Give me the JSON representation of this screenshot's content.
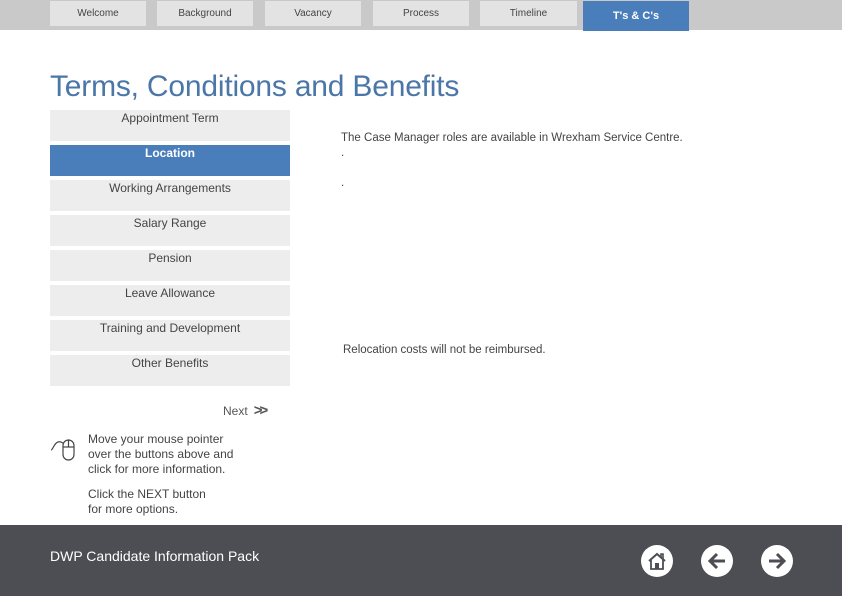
{
  "nav": {
    "tabs": [
      {
        "label": "Welcome",
        "active": false
      },
      {
        "label": "Background",
        "active": false
      },
      {
        "label": "Vacancy",
        "active": false
      },
      {
        "label": "Process",
        "active": false
      },
      {
        "label": "Timeline",
        "active": false
      },
      {
        "label": "T's & C's",
        "active": true
      }
    ]
  },
  "page": {
    "title": "Terms, Conditions and Benefits"
  },
  "menu": {
    "items": [
      {
        "label": "Appointment Term",
        "active": false
      },
      {
        "label": "Location",
        "active": true
      },
      {
        "label": "Working Arrangements",
        "active": false
      },
      {
        "label": "Salary Range",
        "active": false
      },
      {
        "label": "Pension",
        "active": false
      },
      {
        "label": "Leave Allowance",
        "active": false
      },
      {
        "label": "Training and Development",
        "active": false
      },
      {
        "label": "Other Benefits",
        "active": false
      }
    ]
  },
  "content": {
    "line1": "The Case Manager  roles are available in  Wrexham Service Centre.",
    "dot1": ".",
    "dot2": ".",
    "line2": "Relocation costs will not be reimbursed."
  },
  "next": {
    "label": "Next",
    "arrows": ">>"
  },
  "help": {
    "line1": "Move your mouse pointer",
    "line2": "over the buttons above and",
    "line3": "click for more information.",
    "line4": "Click the NEXT button",
    "line5": "for more options."
  },
  "footer": {
    "title": "DWP Candidate Information Pack",
    "buttons": {
      "home": "home-icon",
      "back": "arrow-left-icon",
      "forward": "arrow-right-icon"
    }
  },
  "colors": {
    "accent": "#4a7ebb",
    "title": "#4a76a8",
    "footer": "#4d4e53",
    "tab_bg": "#e3e3e3",
    "menu_bg": "#ededed"
  }
}
